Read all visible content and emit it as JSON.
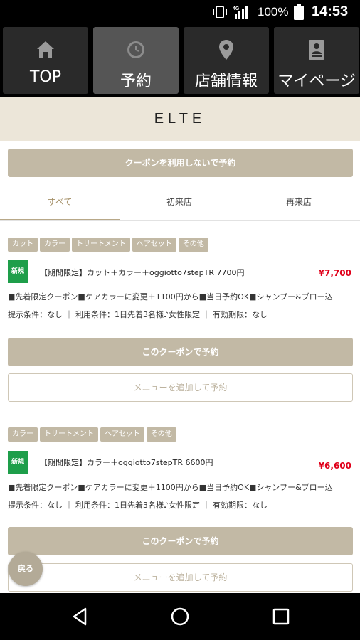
{
  "status_bar": {
    "battery_percent": "100%",
    "time": "14:53",
    "signal_label": "4G"
  },
  "nav": {
    "tabs": [
      {
        "label": "TOP",
        "icon": "home-icon",
        "active": false
      },
      {
        "label": "予約",
        "icon": "clock-icon",
        "active": true
      },
      {
        "label": "店舗情報",
        "icon": "map-pin-icon",
        "active": false
      },
      {
        "label": "マイページ",
        "icon": "user-card-icon",
        "active": false
      }
    ]
  },
  "shop": {
    "name": "ELTE"
  },
  "no_coupon_button": "クーポンを利用しないで予約",
  "filter_tabs": [
    {
      "label": "すべて",
      "active": true
    },
    {
      "label": "初来店",
      "active": false
    },
    {
      "label": "再来店",
      "active": false
    }
  ],
  "coupons": [
    {
      "tags": [
        "カット",
        "カラー",
        "トリートメント",
        "ヘアセット",
        "その他"
      ],
      "badge": "新規",
      "title": "【期間限定】カット＋カラー＋oggiotto7stepTR 7700円",
      "price": "¥7,700",
      "description": "■先着限定クーポン■ケアカラーに変更＋1100円から■当日予約OK■シャンプー&ブロー込",
      "conditions": "提示条件：なし ｜ 利用条件：1日先着3名様♪女性限定 ｜ 有効期限：なし",
      "use_button": "このクーポンで予約",
      "add_button": "メニューを追加して予約"
    },
    {
      "tags": [
        "カラー",
        "トリートメント",
        "ヘアセット",
        "その他"
      ],
      "badge": "新規",
      "title": "【期間限定】カラー＋oggiotto7stepTR 6600円",
      "price": "¥6,600",
      "description": "■先着限定クーポン■ケアカラーに変更＋1100円から■当日予約OK■シャンプー&ブロー込",
      "conditions": "提示条件：なし ｜ 利用条件：1日先着3名様♪女性限定 ｜ 有効期限：なし",
      "use_button": "このクーポンで予約",
      "add_button": "メニューを追加して予約"
    }
  ],
  "back_button": "戻る",
  "colors": {
    "accent": "#c2b9a5",
    "header_bg": "#ece6d9",
    "new_badge": "#1e9e4a",
    "price": "#e0001a",
    "active_tab_text": "#a48f66"
  },
  "android_nav": {
    "back": "back-triangle-icon",
    "home": "home-circle-icon",
    "recents": "recents-square-icon"
  }
}
